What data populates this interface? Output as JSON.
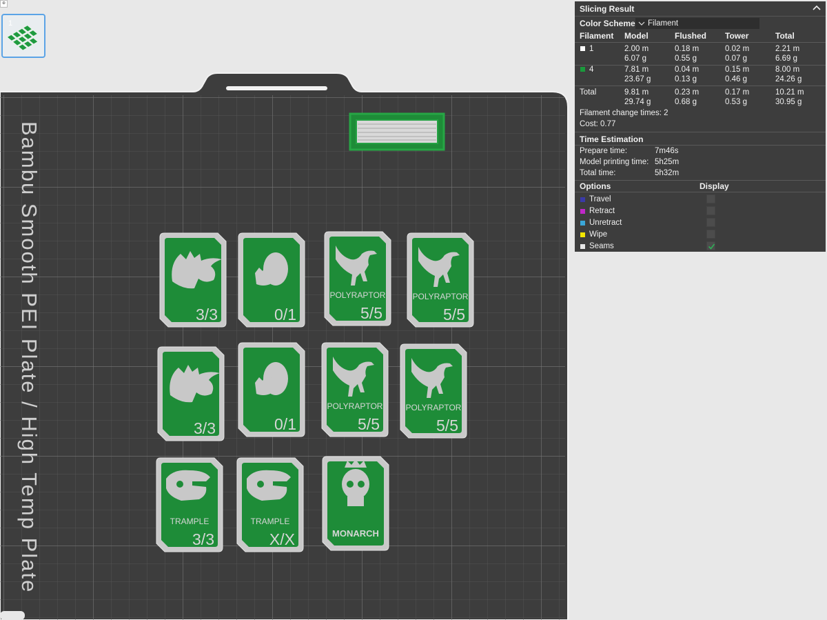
{
  "thumbnail": {
    "index": "1"
  },
  "plate": {
    "label": "Bambu Smooth PEI Plate / High Temp Plate"
  },
  "cards": [
    {
      "icon": "triceratops-icon",
      "caption": "",
      "count": "3/3"
    },
    {
      "icon": "egg-icon",
      "caption": "",
      "count": "0/1"
    },
    {
      "icon": "raptor-icon",
      "caption": "POLYRAPTOR",
      "count": "5/5"
    },
    {
      "icon": "raptor-icon",
      "caption": "POLYRAPTOR",
      "count": "5/5"
    },
    {
      "icon": "triceratops-icon",
      "caption": "",
      "count": "3/3"
    },
    {
      "icon": "egg-icon",
      "caption": "",
      "count": "0/1"
    },
    {
      "icon": "raptor-icon",
      "caption": "POLYRAPTOR",
      "count": "5/5"
    },
    {
      "icon": "raptor-icon",
      "caption": "POLYRAPTOR",
      "count": "5/5"
    },
    {
      "icon": "trex-skull-icon",
      "caption": "TRAMPLE",
      "count": "3/3"
    },
    {
      "icon": "trex-skull-icon",
      "caption": "TRAMPLE",
      "count": "X/X"
    },
    {
      "icon": "crowned-skull-icon",
      "caption": "MONARCH",
      "count": ""
    }
  ],
  "slicing": {
    "title": "Slicing Result",
    "color_scheme_label": "Color Scheme",
    "color_scheme_value": "Filament",
    "headers": [
      "Filament",
      "Model",
      "Flushed",
      "Tower",
      "Total"
    ],
    "rows": [
      {
        "filament": "1",
        "color": "#ffffff",
        "model": [
          "2.00 m",
          "6.07 g"
        ],
        "flushed": [
          "0.18 m",
          "0.55 g"
        ],
        "tower": [
          "0.02 m",
          "0.07 g"
        ],
        "total": [
          "2.21 m",
          "6.69 g"
        ]
      },
      {
        "filament": "4",
        "color": "#1a9a3c",
        "model": [
          "7.81 m",
          "23.67 g"
        ],
        "flushed": [
          "0.04 m",
          "0.13 g"
        ],
        "tower": [
          "0.15 m",
          "0.46 g"
        ],
        "total": [
          "8.00 m",
          "24.26 g"
        ]
      },
      {
        "filament": "Total",
        "color": "",
        "model": [
          "9.81 m",
          "29.74 g"
        ],
        "flushed": [
          "0.23 m",
          "0.68 g"
        ],
        "tower": [
          "0.17 m",
          "0.53 g"
        ],
        "total": [
          "10.21 m",
          "30.95 g"
        ]
      }
    ],
    "filament_change": "Filament change times:  2",
    "cost": "Cost:  0.77",
    "time_title": "Time Estimation",
    "prepare_label": "Prepare time:",
    "prepare_value": "7m46s",
    "model_label": "Model printing time:",
    "model_value": "5h25m",
    "total_label": "Total time:",
    "total_value": "5h32m",
    "options_title": "Options",
    "display_title": "Display",
    "options": [
      {
        "label": "Travel",
        "color": "#3a3aa8",
        "checked": false
      },
      {
        "label": "Retract",
        "color": "#c028c8",
        "checked": false
      },
      {
        "label": "Unretract",
        "color": "#3aa6d8",
        "checked": false
      },
      {
        "label": "Wipe",
        "color": "#f2e600",
        "checked": false
      },
      {
        "label": "Seams",
        "color": "#e6e6e6",
        "checked": true
      }
    ]
  }
}
